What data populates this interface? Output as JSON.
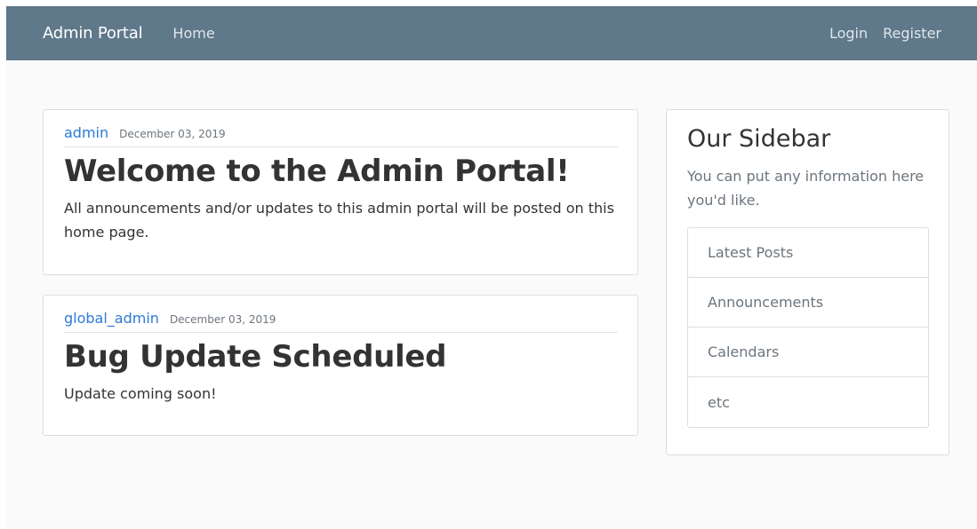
{
  "navbar": {
    "brand": "Admin Portal",
    "home": "Home",
    "login": "Login",
    "register": "Register",
    "background": "#5f788a"
  },
  "posts": [
    {
      "author": "admin",
      "date": "December 03, 2019",
      "title": "Welcome to the Admin Portal!",
      "body": "All announcements and/or updates to this admin portal will be posted on this home page."
    },
    {
      "author": "global_admin",
      "date": "December 03, 2019",
      "title": "Bug Update Scheduled",
      "body": "Update coming soon!"
    }
  ],
  "sidebar": {
    "title": "Our Sidebar",
    "text": "You can put any information here you'd like.",
    "items": [
      "Latest Posts",
      "Announcements",
      "Calendars",
      "etc"
    ]
  },
  "colors": {
    "accent_link": "#2b7bd6",
    "page_background": "#fafafa"
  }
}
